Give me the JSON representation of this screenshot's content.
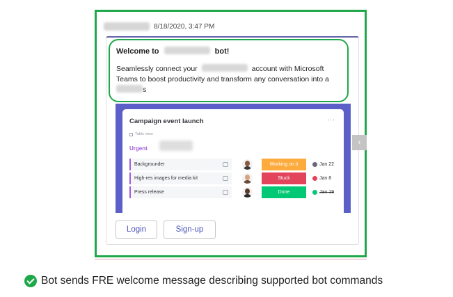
{
  "message": {
    "timestamp": "8/18/2020, 3:47 PM",
    "welcome_prefix": "Welcome to",
    "welcome_suffix": "bot!",
    "body_part1": "Seamlessly connect your",
    "body_part2": "account with Microsoft Teams to boost productivity and transform any conversation into a",
    "body_part3": "s"
  },
  "board": {
    "title": "Campaign event launch",
    "more_icon": "ellipsis-icon",
    "view_label": "Table view",
    "group_label": "Urgent",
    "rows": [
      {
        "task": "Backgrounder",
        "status": "Working on it",
        "status_color": "#fdab3d",
        "date": "Jan 22",
        "date_icon_color": "#676879",
        "done": false
      },
      {
        "task": "High-res images for media kit",
        "status": "Stuck",
        "status_color": "#e2445c",
        "date": "Jan 8",
        "date_icon_color": "#e2445c",
        "done": false
      },
      {
        "task": "Press release",
        "status": "Done",
        "status_color": "#00c875",
        "date": "Jan 19",
        "date_icon_color": "#00c875",
        "done": true
      }
    ]
  },
  "actions": {
    "login_label": "Login",
    "signup_label": "Sign-up"
  },
  "caption": {
    "text": "Bot sends FRE welcome message describing supported bot commands",
    "icon": "check-circle-icon"
  },
  "colors": {
    "highlight": "#1fa84a",
    "teams_purple": "#5b5fc7",
    "group_purple": "#a25ddc",
    "button_text": "#4b53bc"
  }
}
